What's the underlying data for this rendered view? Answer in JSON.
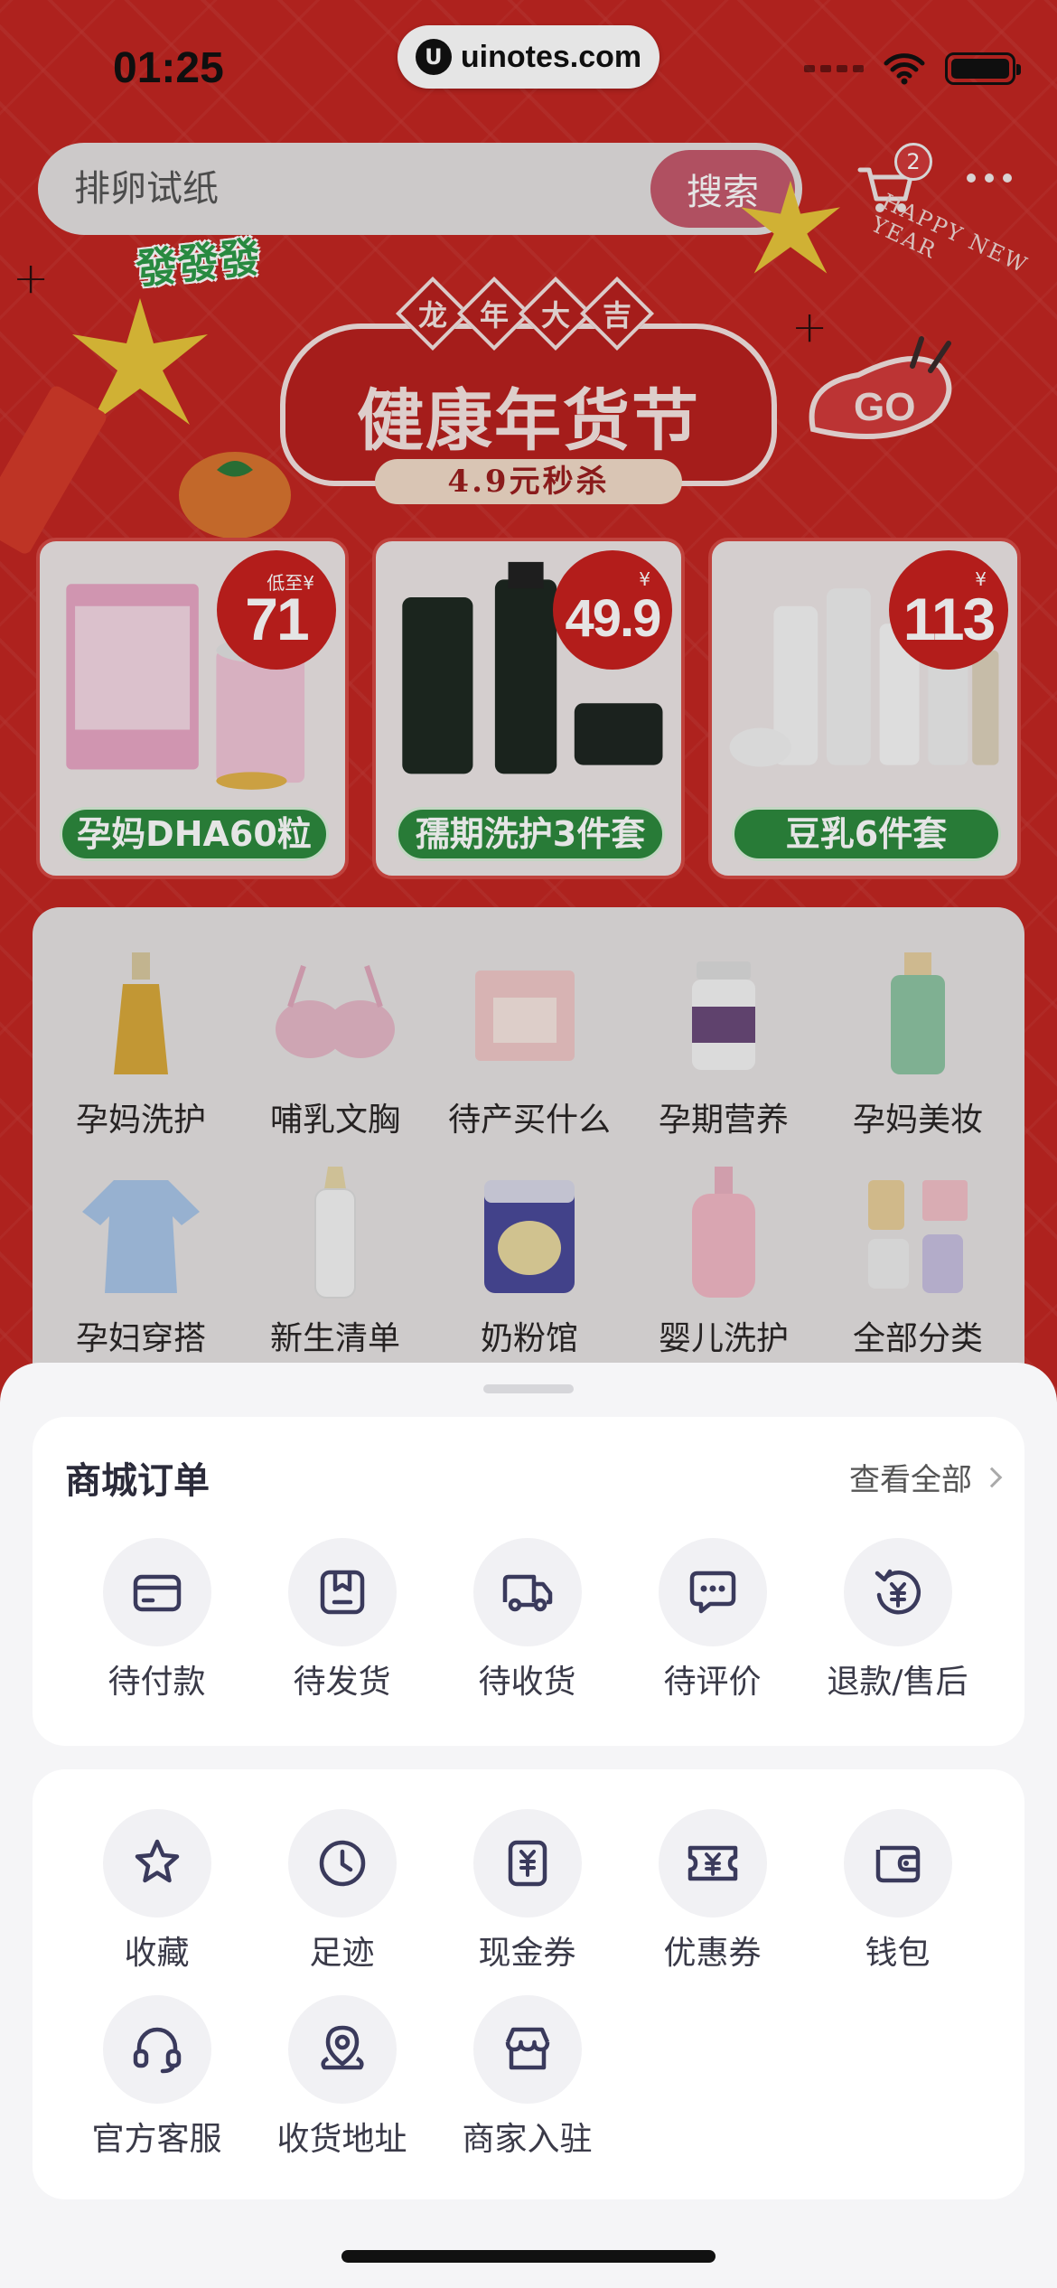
{
  "status_bar": {
    "time": "01:25",
    "watermark": "uinotes.com",
    "watermark_logo": "U"
  },
  "search": {
    "placeholder": "排卵试纸",
    "button_label": "搜索"
  },
  "cart": {
    "badge_count": "2"
  },
  "banner": {
    "top_chars": [
      "龙",
      "年",
      "大",
      "吉"
    ],
    "title": "健康年货节",
    "subtitle": "4.9元秒杀",
    "happy_new_year": "HAPPY NEW YEAR",
    "sticker": "發發發",
    "go_text": "GO"
  },
  "products": [
    {
      "price_prefix": "低至¥",
      "price": "71",
      "label": "孕妈DHA60粒"
    },
    {
      "price_prefix": "¥",
      "price": "49.9",
      "label": "孺期洗护3件套"
    },
    {
      "price_prefix": "¥",
      "price": "113",
      "label": "豆乳6件套"
    }
  ],
  "categories": [
    {
      "label": "孕妈洗护",
      "icon": "oil-bottle-icon"
    },
    {
      "label": "哺乳文胸",
      "icon": "nursing-bra-icon"
    },
    {
      "label": "待产买什么",
      "icon": "maternity-pack-icon"
    },
    {
      "label": "孕期营养",
      "icon": "supplement-jar-icon"
    },
    {
      "label": "孕妈美妆",
      "icon": "cosmetic-bottle-icon"
    },
    {
      "label": "孕妇穿搭",
      "icon": "maternity-shirt-icon"
    },
    {
      "label": "新生清单",
      "icon": "baby-bottle-icon"
    },
    {
      "label": "奶粉馆",
      "icon": "milk-powder-can-icon"
    },
    {
      "label": "婴儿洗护",
      "icon": "baby-wash-bottle-icon"
    },
    {
      "label": "全部分类",
      "icon": "all-categories-icon"
    }
  ],
  "orders": {
    "title": "商城订单",
    "view_all": "查看全部",
    "items": [
      {
        "label": "待付款",
        "icon": "card-icon"
      },
      {
        "label": "待发货",
        "icon": "package-icon"
      },
      {
        "label": "待收货",
        "icon": "truck-icon"
      },
      {
        "label": "待评价",
        "icon": "chat-bubble-icon"
      },
      {
        "label": "退款/售后",
        "icon": "refund-icon"
      }
    ]
  },
  "services": {
    "items": [
      {
        "label": "收藏",
        "icon": "star-icon"
      },
      {
        "label": "足迹",
        "icon": "clock-icon"
      },
      {
        "label": "现金券",
        "icon": "cash-voucher-icon"
      },
      {
        "label": "优惠券",
        "icon": "coupon-icon"
      },
      {
        "label": "钱包",
        "icon": "wallet-icon"
      },
      {
        "label": "官方客服",
        "icon": "headset-icon"
      },
      {
        "label": "收货地址",
        "icon": "location-icon"
      },
      {
        "label": "商家入驻",
        "icon": "store-icon"
      }
    ]
  },
  "colors": {
    "accent": "#3a3a5c",
    "shop_red": "#c22622",
    "green_label": "#2d8a3e",
    "icon_bg": "#f1f1f4"
  }
}
